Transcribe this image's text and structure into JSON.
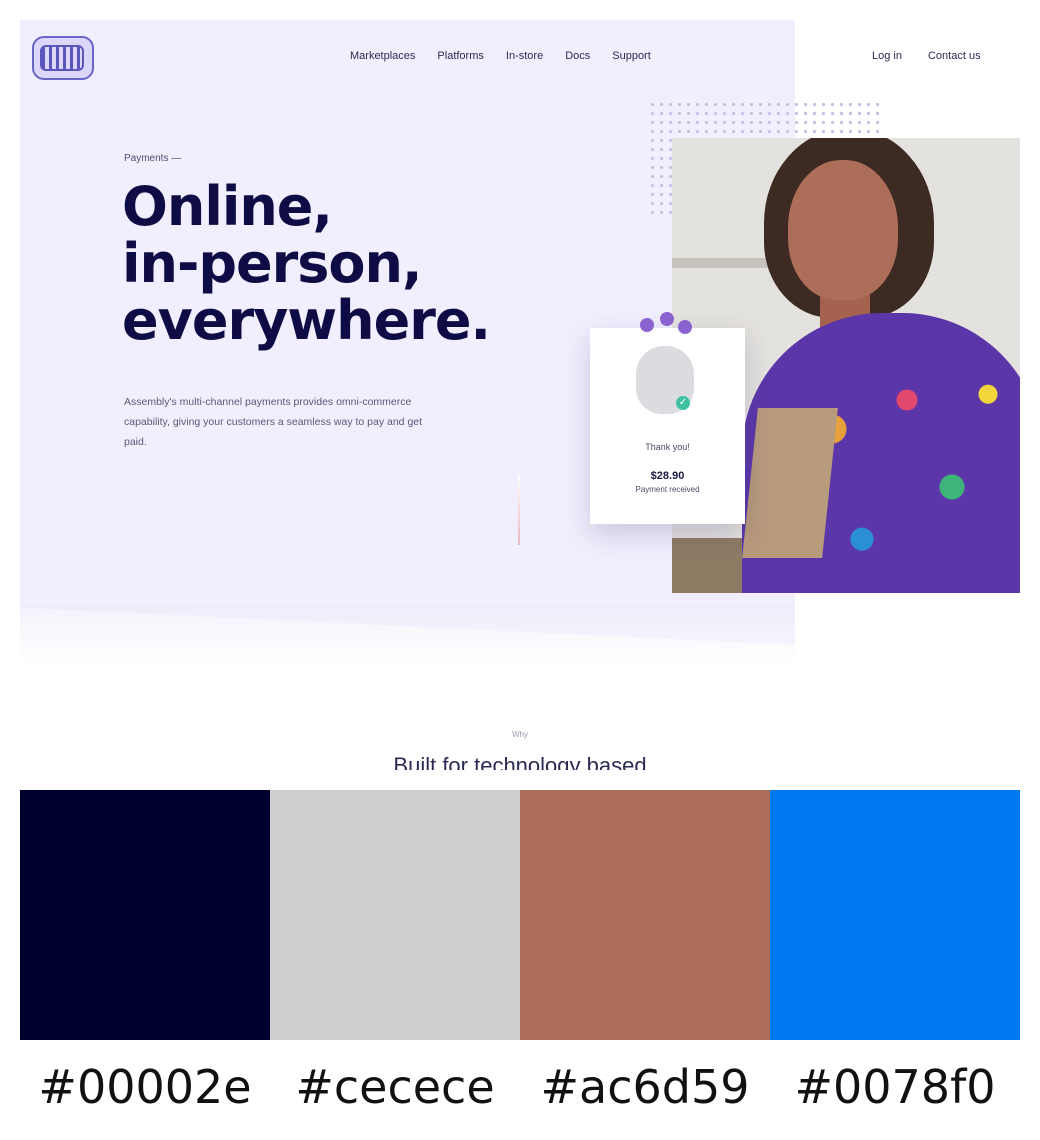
{
  "header": {
    "nav": [
      "Marketplaces",
      "Platforms",
      "In-store",
      "Docs",
      "Support"
    ],
    "auth": [
      "Log in",
      "Contact us"
    ]
  },
  "hero": {
    "eyebrow": "Payments —",
    "headline": [
      "Online,",
      "in-person,",
      "everywhere."
    ],
    "intro": "Assembly's multi-channel payments provides omni-commerce capability, giving your customers a seamless way to pay and get paid."
  },
  "payment_card": {
    "label": "Thank you!",
    "amount": "$28.90",
    "status": "Payment received"
  },
  "next_section": {
    "eyebrow": "Why",
    "title": "Built for technology based"
  },
  "palette": [
    {
      "hex": "#00002e",
      "label": "#00002e"
    },
    {
      "hex": "#cecece",
      "label": "#cecece"
    },
    {
      "hex": "#ac6d59",
      "label": "#ac6d59"
    },
    {
      "hex": "#0078f0",
      "label": "#0078f0"
    }
  ]
}
